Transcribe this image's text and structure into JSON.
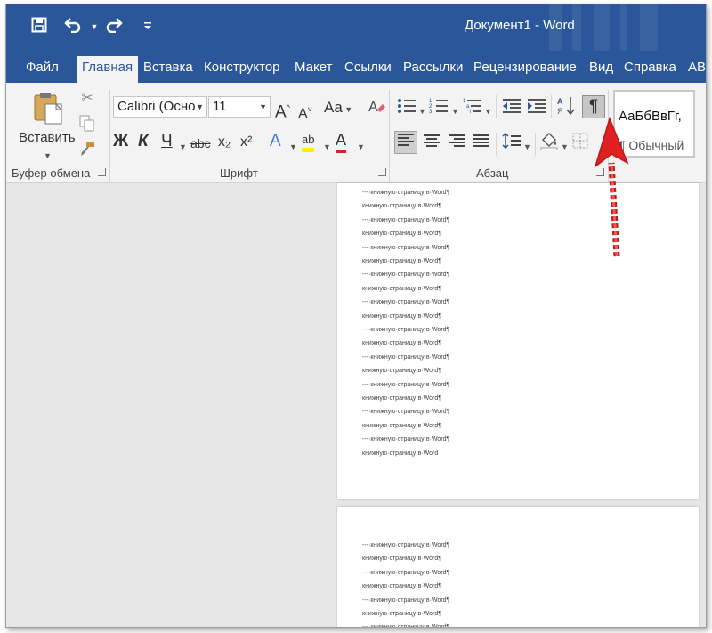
{
  "window": {
    "title": "Документ1  -  Word",
    "accent": "#2b579a"
  },
  "qat": {
    "save_icon": "save-icon",
    "undo_icon": "undo-icon",
    "redo_icon": "redo-icon",
    "customize_icon": "qat-customize-icon"
  },
  "tabs": [
    {
      "label": "Файл"
    },
    {
      "label": "Главная"
    },
    {
      "label": "Вставка"
    },
    {
      "label": "Конструктор"
    },
    {
      "label": "Макет"
    },
    {
      "label": "Ссылки"
    },
    {
      "label": "Рассылки"
    },
    {
      "label": "Рецензирование"
    },
    {
      "label": "Вид"
    },
    {
      "label": "Справка"
    },
    {
      "label": "АВ"
    }
  ],
  "ribbon": {
    "clipboard": {
      "label": "Буфер обмена",
      "paste_label": "Вставить"
    },
    "font": {
      "label": "Шрифт",
      "font_name": "Calibri (Осно",
      "font_size": "11",
      "grow": "A",
      "shrink": "A",
      "case": "Aa",
      "bold": "Ж",
      "italic": "К",
      "underline": "Ч",
      "strike": "abc",
      "subscript": "x₂",
      "superscript": "x²",
      "effects": "A",
      "highlight": "ab",
      "color": "A"
    },
    "paragraph": {
      "label": "Абзац",
      "show_marks": "¶"
    },
    "styles": {
      "sample": "АаБбВвГг,",
      "name": "¶ Обычный"
    }
  },
  "document": {
    "line_text_a": "---·книжную·страницу·в·Word¶",
    "line_text_b": "книжную·страницу·в·Word¶",
    "line_text_last": "книжную·страницу·в·Word",
    "page2_lines": [
      "---·книжную·страницу·в·Word¶",
      "книжную·страницу·в·Word¶",
      "---·книжную·страницу·в·Word¶",
      "книжную·страницу·в·Word¶",
      "---·книжную·страницу·в·Word¶",
      "книжную·страницу·в·Word¶",
      "---·книжную·страницу·в·Word¶"
    ]
  }
}
